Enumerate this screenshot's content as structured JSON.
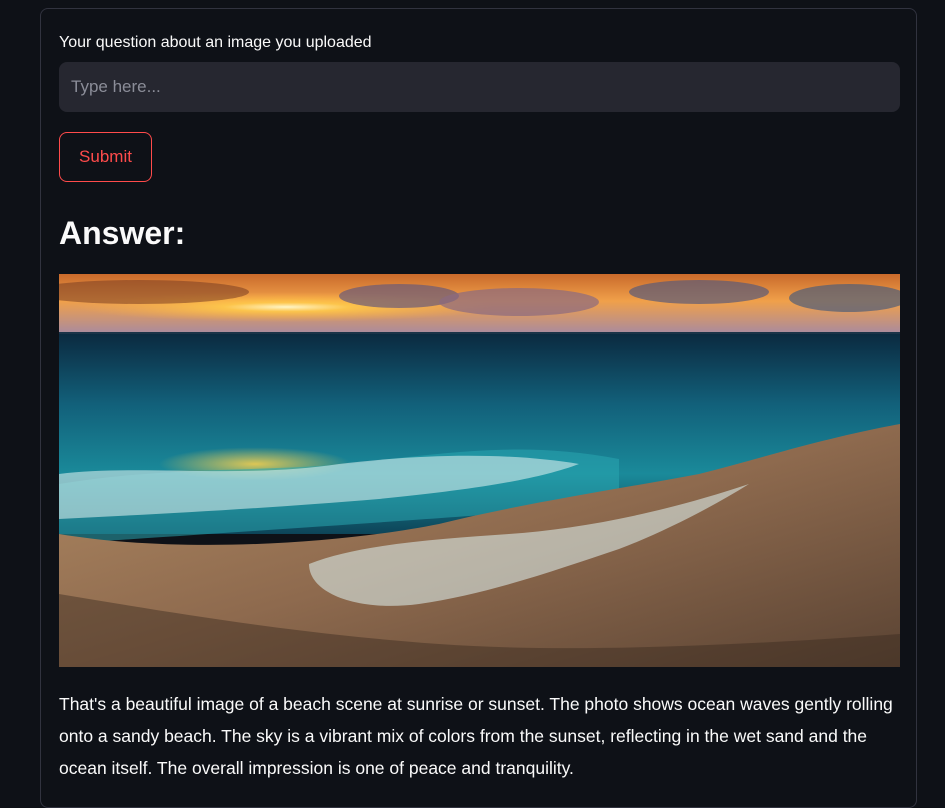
{
  "form": {
    "label": "Your question about an image you uploaded",
    "input_placeholder": "Type here...",
    "input_value": "",
    "submit_label": "Submit"
  },
  "answer": {
    "heading": "Answer:",
    "image_subject": "beach at sunset with ocean waves",
    "text": "That's a beautiful image of a beach scene at sunrise or sunset. The photo shows ocean waves gently rolling onto a sandy beach. The sky is a vibrant mix of colors from the sunset, reflecting in the wet sand and the ocean itself. The overall impression is one of peace and tranquility."
  },
  "colors": {
    "background": "#0e1117",
    "input_background": "#262730",
    "accent": "#ff4b4b",
    "text": "#fafafa"
  }
}
